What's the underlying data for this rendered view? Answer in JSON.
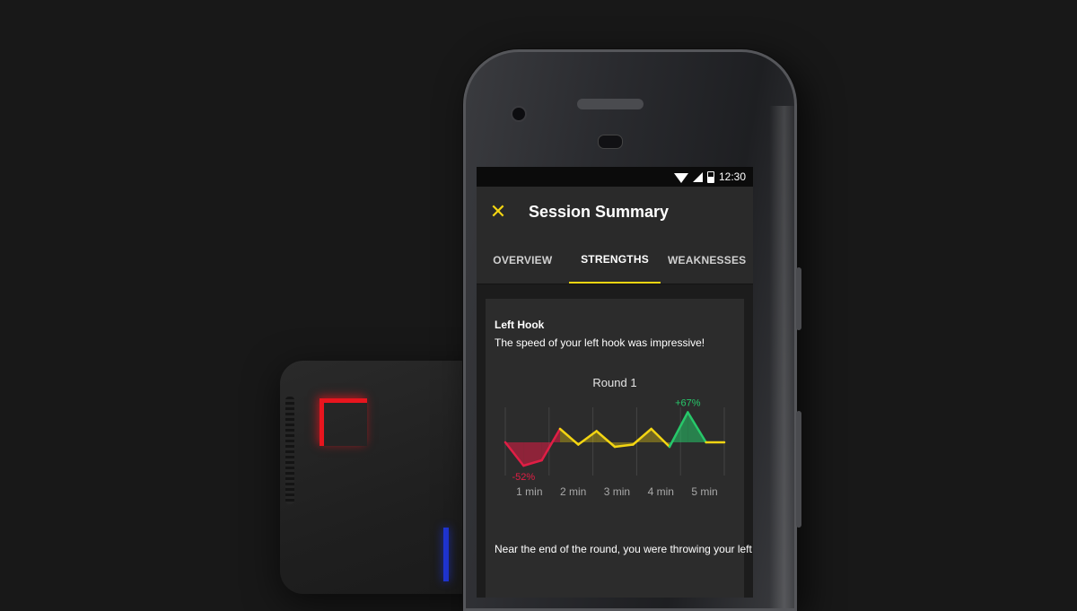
{
  "status_bar": {
    "time": "12:30"
  },
  "app_bar": {
    "title": "Session Summary",
    "close_icon": "close-icon"
  },
  "tabs": [
    {
      "label": "OVERVIEW",
      "active": false
    },
    {
      "label": "STRENGTHS",
      "active": true
    },
    {
      "label": "WEAKNESSES",
      "active": false
    }
  ],
  "card": {
    "title": "Left Hook",
    "description": "The speed of your left hook was impressive!",
    "footer": "Near the end of the round, you were throwing your left"
  },
  "colors": {
    "accent": "#f3d512",
    "positive": "#27c86a",
    "negative": "#e01e45",
    "sensor_red": "#e8151e",
    "sensor_blue": "#2036d8"
  },
  "chart_data": {
    "type": "line",
    "title": "Round 1",
    "x_labels": [
      "1 min",
      "2 min",
      "3 min",
      "4 min",
      "5 min"
    ],
    "baseline": 0,
    "series": [
      {
        "values": [
          0,
          -52,
          -40,
          30,
          -5,
          25,
          -10,
          -5,
          30,
          -10,
          67,
          0,
          0
        ]
      }
    ],
    "annotations": [
      {
        "text": "+67%",
        "value": 67
      },
      {
        "text": "-52%",
        "value": -52
      }
    ],
    "grid": true
  }
}
